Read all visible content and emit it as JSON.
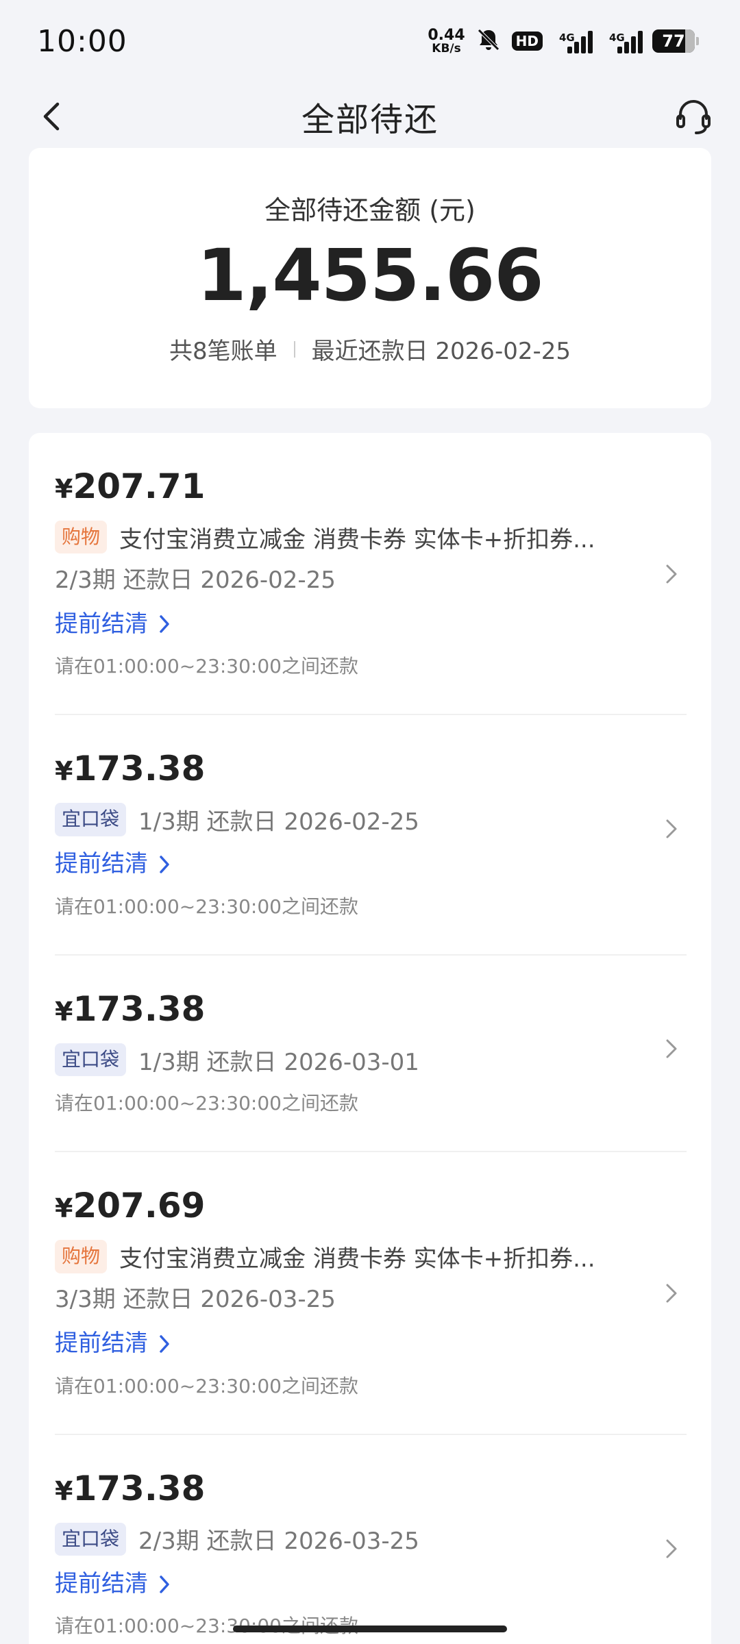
{
  "status_bar": {
    "time": "10:00",
    "net_speed_value": "0.44",
    "net_speed_unit": "KB/s",
    "hd": "HD",
    "network_1": "4G",
    "network_2": "4G",
    "battery": "77",
    "icons": [
      "mute-icon",
      "signal-icon",
      "signal-icon",
      "battery-icon"
    ]
  },
  "header": {
    "title": "全部待还",
    "back_icon": "chevron-left-icon",
    "support_icon": "headset-icon"
  },
  "summary": {
    "label": "全部待还金额 (元)",
    "amount": "1,455.66",
    "bill_count": "共8笔账单",
    "recent_due": "最近还款日 2026-02-25"
  },
  "bills": [
    {
      "currency": "¥",
      "amount": "207.71",
      "tag": "购物",
      "description": "支付宝消费立减金 消费卡券 实体卡+折扣券...",
      "period": "2/3期 还款日 2026-02-25",
      "settle_label": "提前结清",
      "hint": "请在01:00:00~23:30:00之间还款"
    },
    {
      "currency": "¥",
      "amount": "173.38",
      "tag": "宜口袋",
      "period": "1/3期 还款日 2026-02-25",
      "settle_label": "提前结清",
      "hint": "请在01:00:00~23:30:00之间还款"
    },
    {
      "currency": "¥",
      "amount": "173.38",
      "tag": "宜口袋",
      "period": "1/3期 还款日 2026-03-01",
      "hint": "请在01:00:00~23:30:00之间还款"
    },
    {
      "currency": "¥",
      "amount": "207.69",
      "tag": "购物",
      "description": "支付宝消费立减金 消费卡券 实体卡+折扣券...",
      "period": "3/3期 还款日 2026-03-25",
      "settle_label": "提前结清",
      "hint": "请在01:00:00~23:30:00之间还款"
    },
    {
      "currency": "¥",
      "amount": "173.38",
      "tag": "宜口袋",
      "period": "2/3期 还款日 2026-03-25",
      "settle_label": "提前结清",
      "hint": "请在01:00:00~23:30:00之间还款"
    }
  ],
  "colors": {
    "background": "#f3f4f8",
    "link": "#2f5fe0",
    "shopping_tag_bg": "#fdeee6",
    "shopping_tag_text": "#e5753c",
    "loan_tag_bg": "#e9ecf8",
    "loan_tag_text": "#3b4a85"
  }
}
